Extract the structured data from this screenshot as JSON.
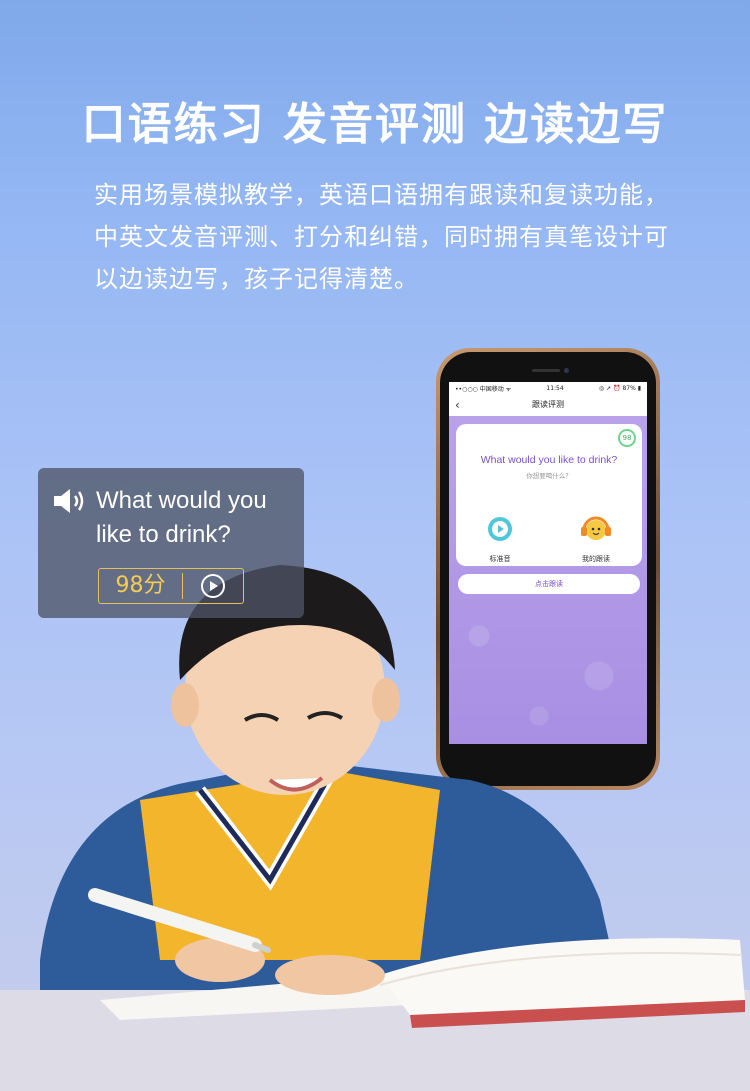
{
  "headline": "口语练习 发音评测 边读边写",
  "subtitle": "实用场景模拟教学，英语口语拥有跟读和复读功能，中英文发音评测、打分和纠错，同时拥有真笔设计可以边读边写，孩子记得清楚。",
  "speech_card": {
    "text": "What would you like to drink?",
    "score": "98分",
    "icons": [
      "speaker-icon",
      "play-icon"
    ]
  },
  "phone": {
    "status": {
      "carrier": "••○○○ 中国移动 ᯤ",
      "time": "11:54",
      "battery": "◎ ➚ ⏰ 87% ▮"
    },
    "nav_title": "跟读评测",
    "score_badge": "98",
    "question_en": "What would you like to drink?",
    "question_cn": "你想要喝什么？",
    "standard_label": "标准音",
    "mine_label": "我的跟读",
    "follow_button": "点击跟读"
  },
  "colors": {
    "accent_purple": "#7a4fd2",
    "score_gold": "#f5cd52",
    "score_green": "#6fd48c"
  }
}
